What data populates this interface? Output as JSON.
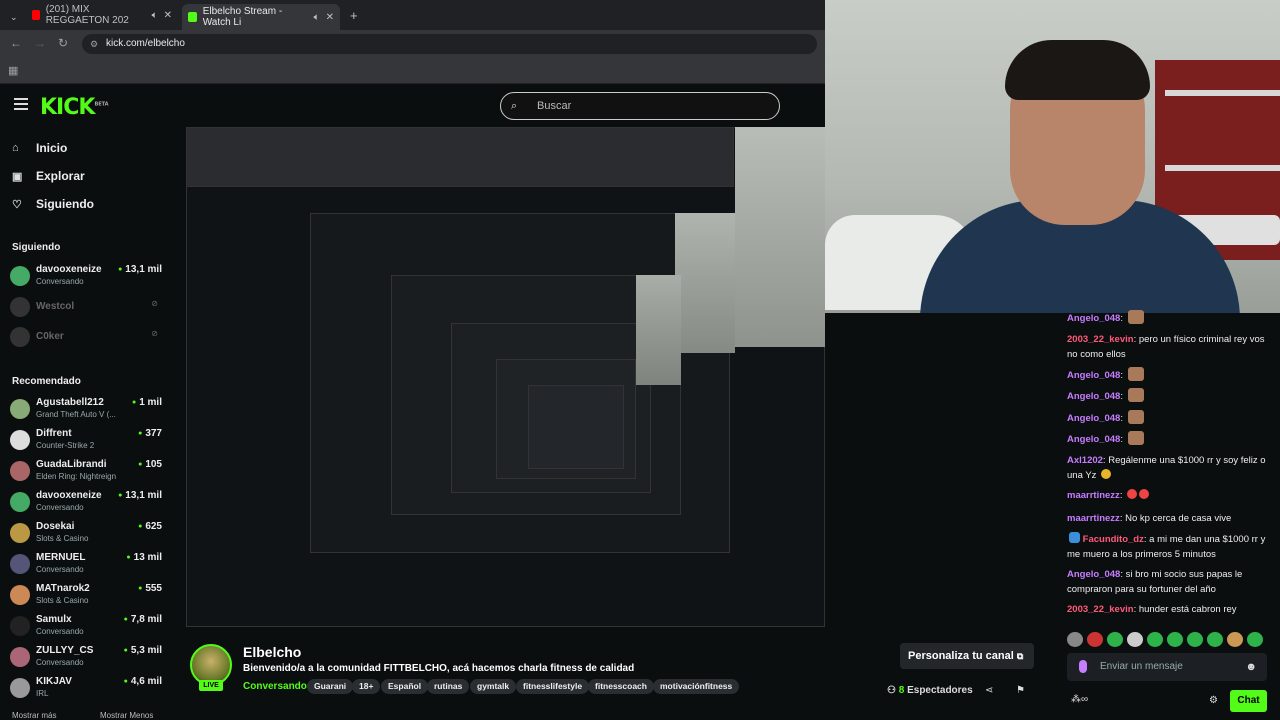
{
  "browser": {
    "tabs": [
      {
        "title": "(201) MIX REGGAETON 202"
      },
      {
        "title": "Elbelcho Stream - Watch Li"
      }
    ],
    "new_tab_label": "+",
    "url": "kick.com/elbelcho"
  },
  "header": {
    "logo": "KICK",
    "logo_badge": "BETA",
    "search_placeholder": "Buscar"
  },
  "sidebar": {
    "nav": [
      {
        "label": "Inicio",
        "icon": "home-icon"
      },
      {
        "label": "Explorar",
        "icon": "compass-icon"
      },
      {
        "label": "Siguiendo",
        "icon": "heart-icon"
      }
    ],
    "following_title": "Siguiendo",
    "following": [
      {
        "name": "davooxeneize",
        "sub": "Conversando",
        "viewers": "13,1 mil"
      },
      {
        "name": "Westcol",
        "offline": true
      },
      {
        "name": "C0ker",
        "offline": true
      }
    ],
    "recommended_title": "Recomendado",
    "recommended": [
      {
        "name": "Agustabell212",
        "sub": "Grand Theft Auto V (...",
        "viewers": "1 mil"
      },
      {
        "name": "Diffrent",
        "sub": "Counter-Strike 2",
        "viewers": "377"
      },
      {
        "name": "GuadaLibrandi",
        "sub": "Elden Ring: Nightreign",
        "viewers": "105"
      },
      {
        "name": "davooxeneize",
        "sub": "Conversando",
        "viewers": "13,1 mil"
      },
      {
        "name": "Dosekai",
        "sub": "Slots & Casino",
        "viewers": "625"
      },
      {
        "name": "MERNUEL",
        "sub": "Conversando",
        "viewers": "13 mil"
      },
      {
        "name": "MATnarok2",
        "sub": "Slots & Casino",
        "viewers": "555"
      },
      {
        "name": "Samulx",
        "sub": "Conversando",
        "viewers": "7,8 mil"
      },
      {
        "name": "ZULLYY_CS",
        "sub": "Conversando",
        "viewers": "5,3 mil"
      },
      {
        "name": "KIKJAV",
        "sub": "IRL",
        "viewers": "4,6 mil"
      }
    ],
    "show_more": "Mostrar más",
    "show_less": "Mostrar Menos"
  },
  "chat": {
    "messages": [
      {
        "user": "Angelo_048",
        "color": "#c77dff",
        "text": ""
      },
      {
        "user": "2003_22_kevin",
        "color": "#ff5a7a",
        "text": "pero un físico criminal rey vos no como ellos"
      },
      {
        "user": "Angelo_048",
        "color": "#c77dff",
        "text": ""
      },
      {
        "user": "Angelo_048",
        "color": "#c77dff",
        "text": ""
      },
      {
        "user": "Angelo_048",
        "color": "#c77dff",
        "text": ""
      },
      {
        "user": "Angelo_048",
        "color": "#c77dff",
        "text": ""
      },
      {
        "user": "Axl1202",
        "color": "#c77dff",
        "text": "Regálenme una $1000 rr y soy feliz o una Yz"
      },
      {
        "user": "maarrtinezz",
        "color": "#c77dff",
        "text": ""
      },
      {
        "user": "maarrtinezz",
        "color": "#c77dff",
        "text": "No kp cerca de casa vive"
      },
      {
        "user": "Facundito_dz",
        "color": "#ff5a7a",
        "text": "a mi me dan una $1000 rr y me muero a los primeros 5 minutos"
      },
      {
        "user": "Angelo_048",
        "color": "#c77dff",
        "text": "si bro mi socio sus papas le compraron para su fortuner del año"
      },
      {
        "user": "2003_22_kevin",
        "color": "#ff5a7a",
        "text": "hunder está cabron rey"
      }
    ],
    "input_placeholder": "Enviar un mensaje",
    "send_label": "Chat"
  },
  "channel": {
    "name": "Elbelcho",
    "live_label": "LIVE",
    "description": "Bienvenido/a a la comunidad FITTBELCHO, acá hacemos charla fitness de calidad",
    "category": "Conversando",
    "tags": [
      "Guarani",
      "18+",
      "Español",
      "rutinas",
      "gymtalk",
      "fitnesslifestyle",
      "fitnesscoach",
      "motivaciónfitness"
    ],
    "personaliza_label": "Personaliza tu canal",
    "viewers_count": "8",
    "viewers_label": "Espectadores"
  },
  "colors": {
    "accent": "#53fc18",
    "background": "#0b0e0f"
  }
}
